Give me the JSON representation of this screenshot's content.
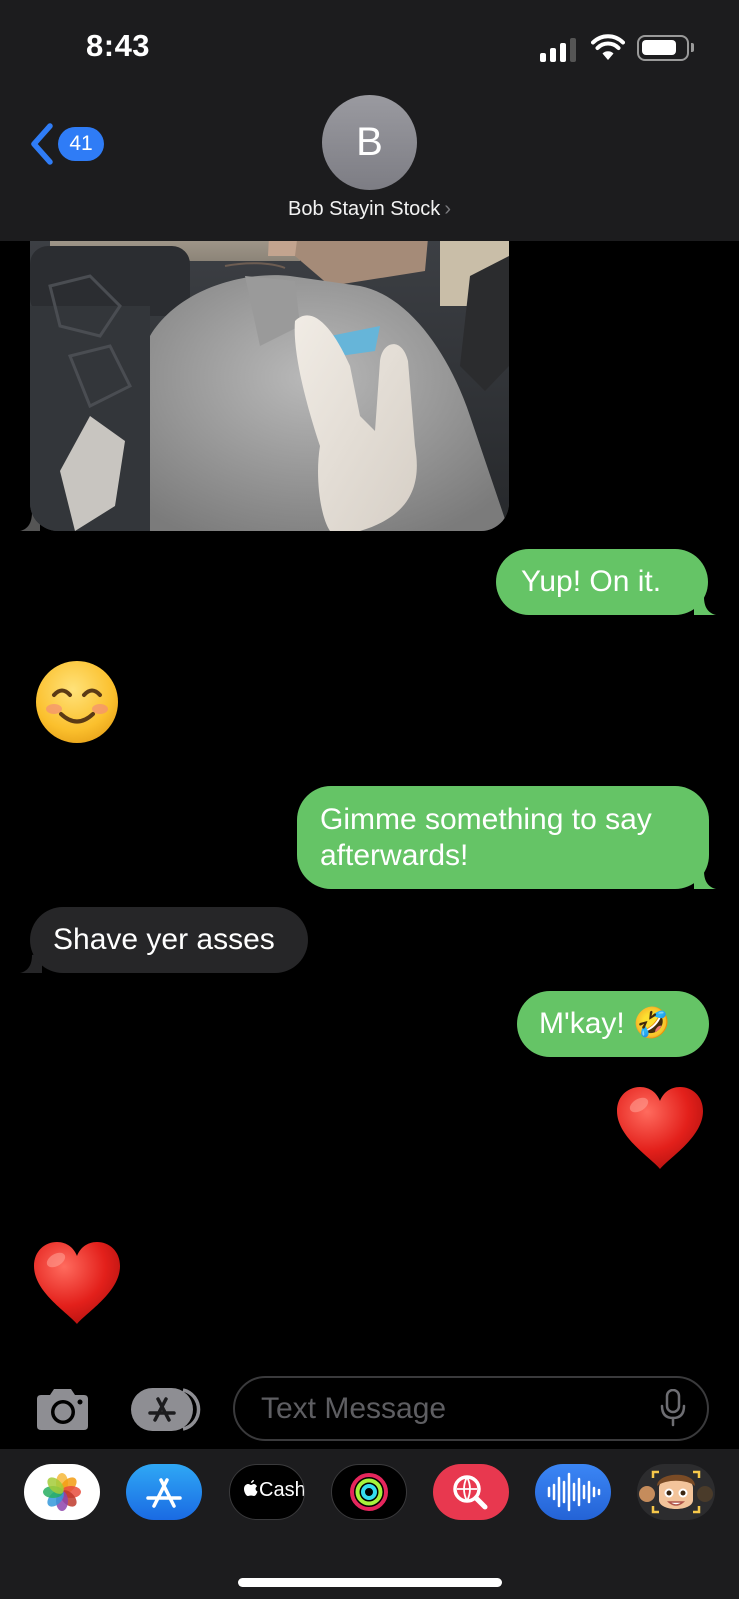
{
  "status_bar": {
    "time": "8:43",
    "signal_bars": 3,
    "battery_level": 0.8
  },
  "header": {
    "back_badge": "41",
    "avatar_initial": "B",
    "contact_name": "Bob Stayin Stock"
  },
  "messages": [
    {
      "direction": "incoming",
      "type": "photo"
    },
    {
      "direction": "outgoing",
      "type": "text",
      "text": "Yup!  On it."
    },
    {
      "direction": "incoming",
      "type": "emoji",
      "text": "😊"
    },
    {
      "direction": "outgoing",
      "type": "text",
      "text": "Gimme something to say afterwards!"
    },
    {
      "direction": "incoming",
      "type": "text",
      "text": "Shave yer asses"
    },
    {
      "direction": "outgoing",
      "type": "text",
      "text": "M'kay! 🤣"
    },
    {
      "direction": "outgoing",
      "type": "emoji",
      "text": "❤️"
    },
    {
      "direction": "incoming",
      "type": "emoji",
      "text": "❤️"
    }
  ],
  "compose": {
    "placeholder": "Text Message"
  },
  "app_drawer": [
    {
      "name": "Photos",
      "icon": "photos-icon"
    },
    {
      "name": "App Store",
      "icon": "app-store-icon"
    },
    {
      "name": "Apple Cash",
      "label": "Cash",
      "icon": "apple-cash-icon"
    },
    {
      "name": "Activity",
      "icon": "activity-rings-icon"
    },
    {
      "name": "Images",
      "icon": "image-search-icon"
    },
    {
      "name": "Audio",
      "icon": "audio-waveform-icon"
    },
    {
      "name": "Memoji",
      "icon": "memoji-icon"
    }
  ],
  "colors": {
    "outgoing_bubble": "#65c466",
    "incoming_bubble": "#262628",
    "header_background": "#1c1c1e",
    "accent_blue": "#2f7cf6",
    "background": "#000000"
  }
}
